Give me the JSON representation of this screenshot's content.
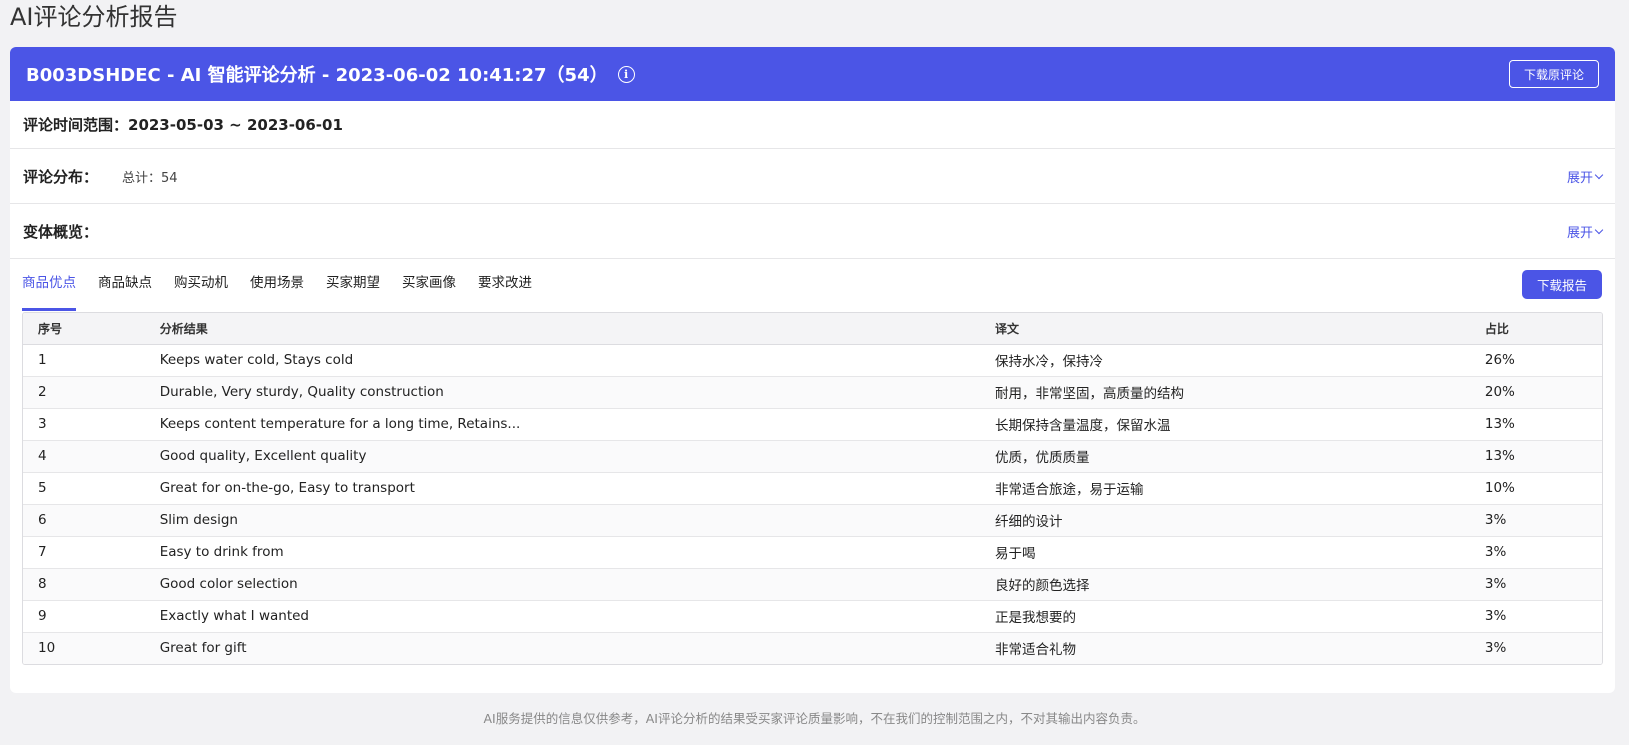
{
  "page": {
    "title": "AI评论分析报告"
  },
  "header": {
    "title": "B003DSHDEC - AI 智能评论分析 - 2023-06-02 10:41:27（54）",
    "download_raw_label": "下载原评论"
  },
  "review_range": {
    "text": "评论时间范围：2023-05-03 ~ 2023-06-01"
  },
  "distribution": {
    "label": "评论分布：",
    "total": "总计：54",
    "expand_label": "展开"
  },
  "variants": {
    "label": "变体概览：",
    "expand_label": "展开"
  },
  "tabs": [
    {
      "label": "商品优点"
    },
    {
      "label": "商品缺点"
    },
    {
      "label": "购买动机"
    },
    {
      "label": "使用场景"
    },
    {
      "label": "买家期望"
    },
    {
      "label": "买家画像"
    },
    {
      "label": "要求改进"
    }
  ],
  "download_report_label": "下载报告",
  "table": {
    "columns": [
      "序号",
      "分析结果",
      "译文",
      "占比"
    ],
    "rows": [
      [
        "1",
        "Keeps water cold, Stays cold",
        "保持水冷，保持冷",
        "26%"
      ],
      [
        "2",
        "Durable, Very sturdy, Quality construction",
        "耐用，非常坚固，高质量的结构",
        "20%"
      ],
      [
        "3",
        "Keeps content temperature for a long time, Retains...",
        "长期保持含量温度，保留水温",
        "13%"
      ],
      [
        "4",
        "Good quality, Excellent quality",
        "优质，优质质量",
        "13%"
      ],
      [
        "5",
        "Great for on-the-go, Easy to transport",
        "非常适合旅途，易于运输",
        "10%"
      ],
      [
        "6",
        "Slim design",
        "纤细的设计",
        "3%"
      ],
      [
        "7",
        "Easy to drink from",
        "易于喝",
        "3%"
      ],
      [
        "8",
        "Good color selection",
        "良好的颜色选择",
        "3%"
      ],
      [
        "9",
        "Exactly what I wanted",
        "正是我想要的",
        "3%"
      ],
      [
        "10",
        "Great for gift",
        "非常适合礼物",
        "3%"
      ]
    ]
  },
  "footer": {
    "note": "AI服务提供的信息仅供参考，AI评论分析的结果受买家评论质量影响，不在我们的控制范围之内，不对其输出内容负责。"
  },
  "colors": {
    "accent": "#4b55e6"
  }
}
